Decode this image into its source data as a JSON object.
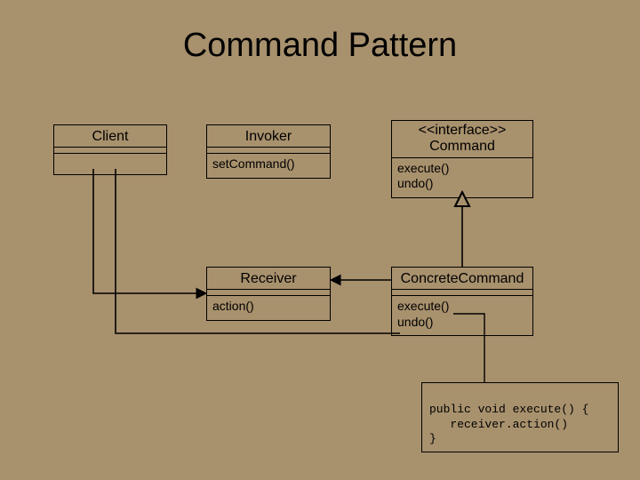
{
  "title": "Command Pattern",
  "boxes": {
    "client": {
      "title": "Client"
    },
    "invoker": {
      "title": "Invoker",
      "body": "setCommand()"
    },
    "command": {
      "title1": "<<interface>>",
      "title2": "Command",
      "body1": "execute()",
      "body2": "undo()"
    },
    "receiver": {
      "title": "Receiver",
      "body": "action()"
    },
    "concrete": {
      "title": "ConcreteCommand",
      "body1": "execute()",
      "body2": "undo()"
    }
  },
  "note": {
    "line1": "public void execute() {",
    "line2": "   receiver.action()",
    "line3": "}"
  }
}
